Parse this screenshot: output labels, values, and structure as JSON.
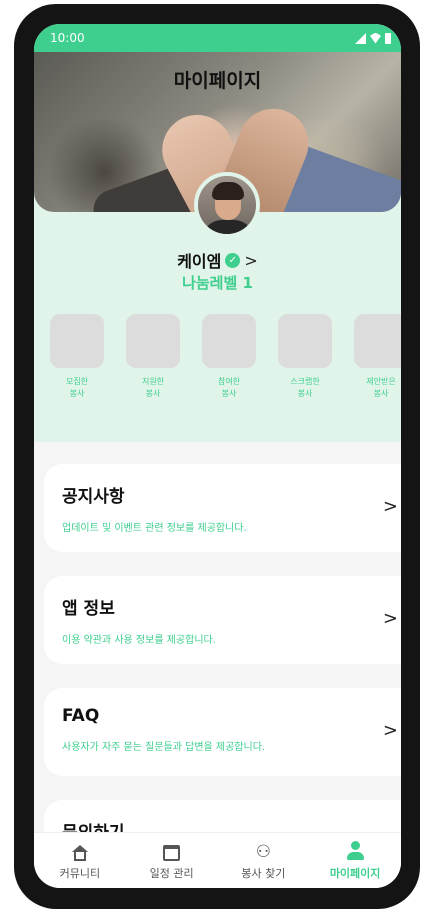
{
  "status_bar": {
    "time": "10:00"
  },
  "header": {
    "title": "마이페이지"
  },
  "profile": {
    "name": "케이엠",
    "verified_mark": "✓",
    "chevron": ">",
    "level": "나눔레벨 1"
  },
  "stats": [
    {
      "label": "모집한\n봉사"
    },
    {
      "label": "지원한\n봉사"
    },
    {
      "label": "참여한\n봉사"
    },
    {
      "label": "스크랩한\n봉사"
    },
    {
      "label": "제안받은\n봉사"
    }
  ],
  "menu": [
    {
      "title": "공지사항",
      "desc": "업데이트 및 이벤트 관련 정보를 제공합니다."
    },
    {
      "title": "앱 정보",
      "desc": "이용 약관과 사용 정보를 제공합니다."
    },
    {
      "title": "FAQ",
      "desc": "사용자가 자주 묻는 질문들과 답변을 제공합니다."
    },
    {
      "title": "문의하기",
      "desc": ""
    }
  ],
  "menu_chevron": ">",
  "tabs": [
    {
      "label": "커뮤니티",
      "icon": "home-icon"
    },
    {
      "label": "일정 관리",
      "icon": "calendar-icon"
    },
    {
      "label": "봉사 찾기",
      "icon": "volunteer-icon"
    },
    {
      "label": "마이페이지",
      "icon": "person-icon",
      "active": true
    }
  ],
  "colors": {
    "accent": "#3ecf8e",
    "profile_bg": "#e1f4e9",
    "stat_box": "#dcdcdc"
  }
}
